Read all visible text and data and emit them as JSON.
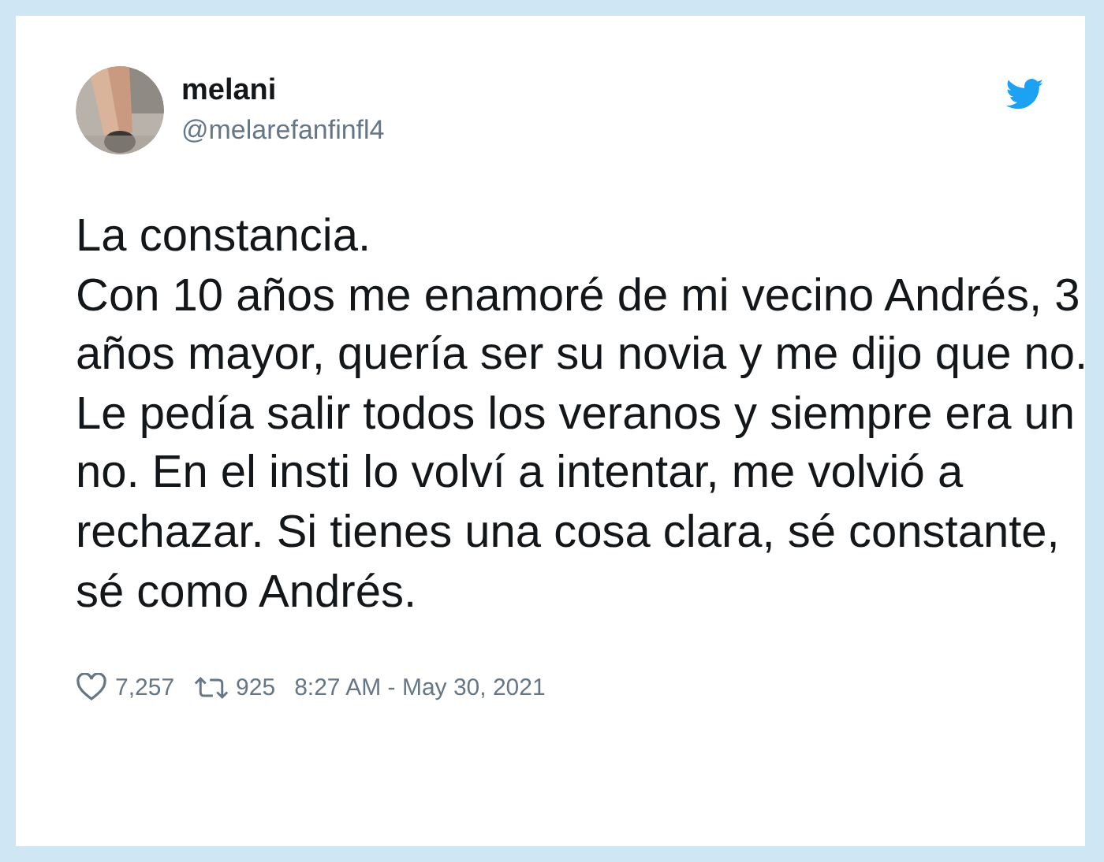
{
  "author": {
    "name": "melani",
    "handle": "@melarefanfinfl4"
  },
  "tweet": {
    "text": "La constancia.\nCon 10 años me enamoré de mi vecino Andrés, 3 años mayor, quería ser su novia y me dijo que no. Le pedía salir todos los veranos y siempre era un no. En el insti lo volví a intentar, me volvió a rechazar. Si tienes una cosa clara, sé constante, sé como Andrés."
  },
  "footer": {
    "likes": "7,257",
    "retweets": "925",
    "timestamp": "8:27 AM - May 30, 2021"
  }
}
